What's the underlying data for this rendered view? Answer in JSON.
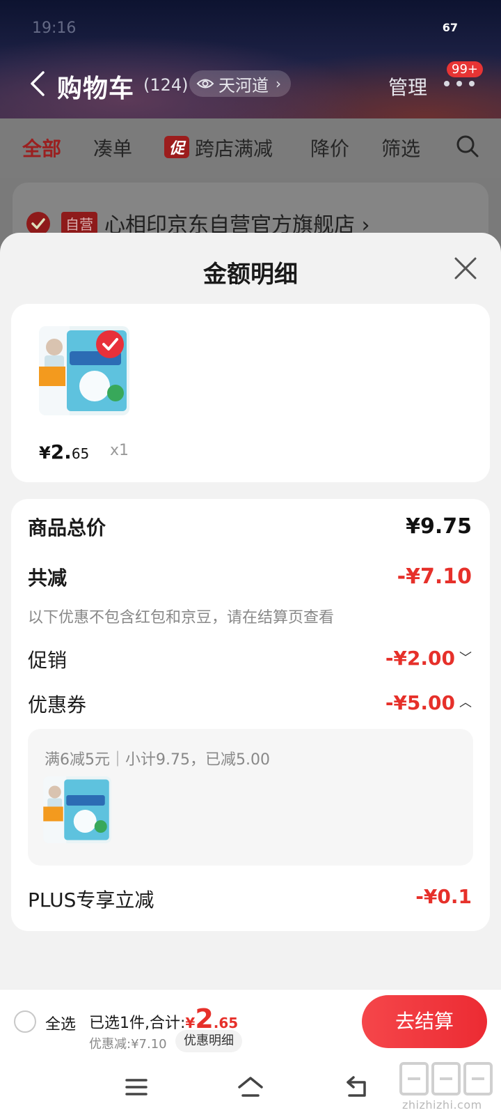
{
  "status_bar": {
    "time": "19:16",
    "battery": "67"
  },
  "header": {
    "title": "购物车",
    "count": "(124)",
    "location": "天河道",
    "location_arrow": "›",
    "manage": "管理",
    "message_badge": "99+"
  },
  "filters": {
    "all": "全部",
    "bundle": "凑单",
    "promo_badge": "促",
    "cross_store": "跨店满减",
    "price_drop": "降价",
    "filter": "筛选"
  },
  "store": {
    "badge": "自营",
    "name": "心相印京东自营官方旗舰店 ›"
  },
  "sheet": {
    "title": "金额明细",
    "item": {
      "price_symbol": "¥",
      "price_int": "2.",
      "price_dec": "65",
      "qty": "x1"
    },
    "summary": {
      "total_label": "商品总价",
      "total_value": "¥9.75",
      "discount_label": "共减",
      "discount_value": "-¥7.10",
      "note": "以下优惠不包含红包和京豆，请在结算页查看",
      "promo_label": "促销",
      "promo_value": "-¥2.00",
      "coupon_label": "优惠券",
      "coupon_value": "-¥5.00",
      "coupon_detail": "满6减5元｜小计9.75，已减5.00",
      "plus_label": "PLUS专享立减",
      "plus_value": "-¥0.1"
    }
  },
  "checkout": {
    "select_all": "全选",
    "selected_prefix": "已选1件,合计:",
    "total_symbol": "¥",
    "total_int": "2",
    "total_dec": ".65",
    "discount_line": "优惠减:¥7.10",
    "detail_button": "优惠明细",
    "checkout_button": "去结算"
  },
  "watermark": "zhizhizhi.com",
  "colors": {
    "accent_red": "#e6302a",
    "checkout_red": "#ec2b33",
    "sheet_bg": "#f2f2f2"
  }
}
